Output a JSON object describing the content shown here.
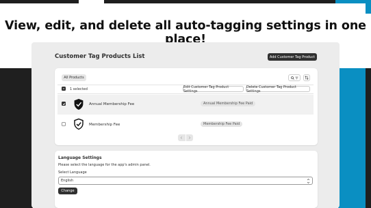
{
  "headline": "View, edit, and delete all auto-tagging settings in one place!",
  "colors": {
    "accent_blue": "#0a8fc2",
    "dark": "#1f1f1f",
    "button_dark": "#303030",
    "panel_bg": "#ececec"
  },
  "header": {
    "title": "Customer Tag Products List",
    "add_button_label": "Add Customer Tag Product"
  },
  "list": {
    "tabs": [
      {
        "label": "All Products"
      }
    ],
    "toolbar_icons": {
      "search": "search-icon",
      "filter": "filter-icon",
      "sort": "sort-icon"
    },
    "bulk": {
      "selected_text": "1 selected",
      "edit_label": "Edit Customer Tag Product Settings",
      "delete_label": "Delete Customer Tag Product Settings"
    },
    "rows": [
      {
        "selected": true,
        "icon": "membership-shield-check-icon",
        "name": "Annual Membership Fee",
        "badge": "Annual Membership Fee Paid"
      },
      {
        "selected": false,
        "icon": "membership-shield-check-icon",
        "name": "Membership Fee",
        "badge": "Membership Fee Paid"
      }
    ],
    "pagination": {
      "prev_icon": "chevron-left-icon",
      "next_icon": "chevron-right-icon"
    }
  },
  "language": {
    "title": "Language Settings",
    "description": "Please select the language for the app's admin panel.",
    "select_label": "Select Language",
    "selected_value": "English",
    "change_button_label": "Change"
  }
}
